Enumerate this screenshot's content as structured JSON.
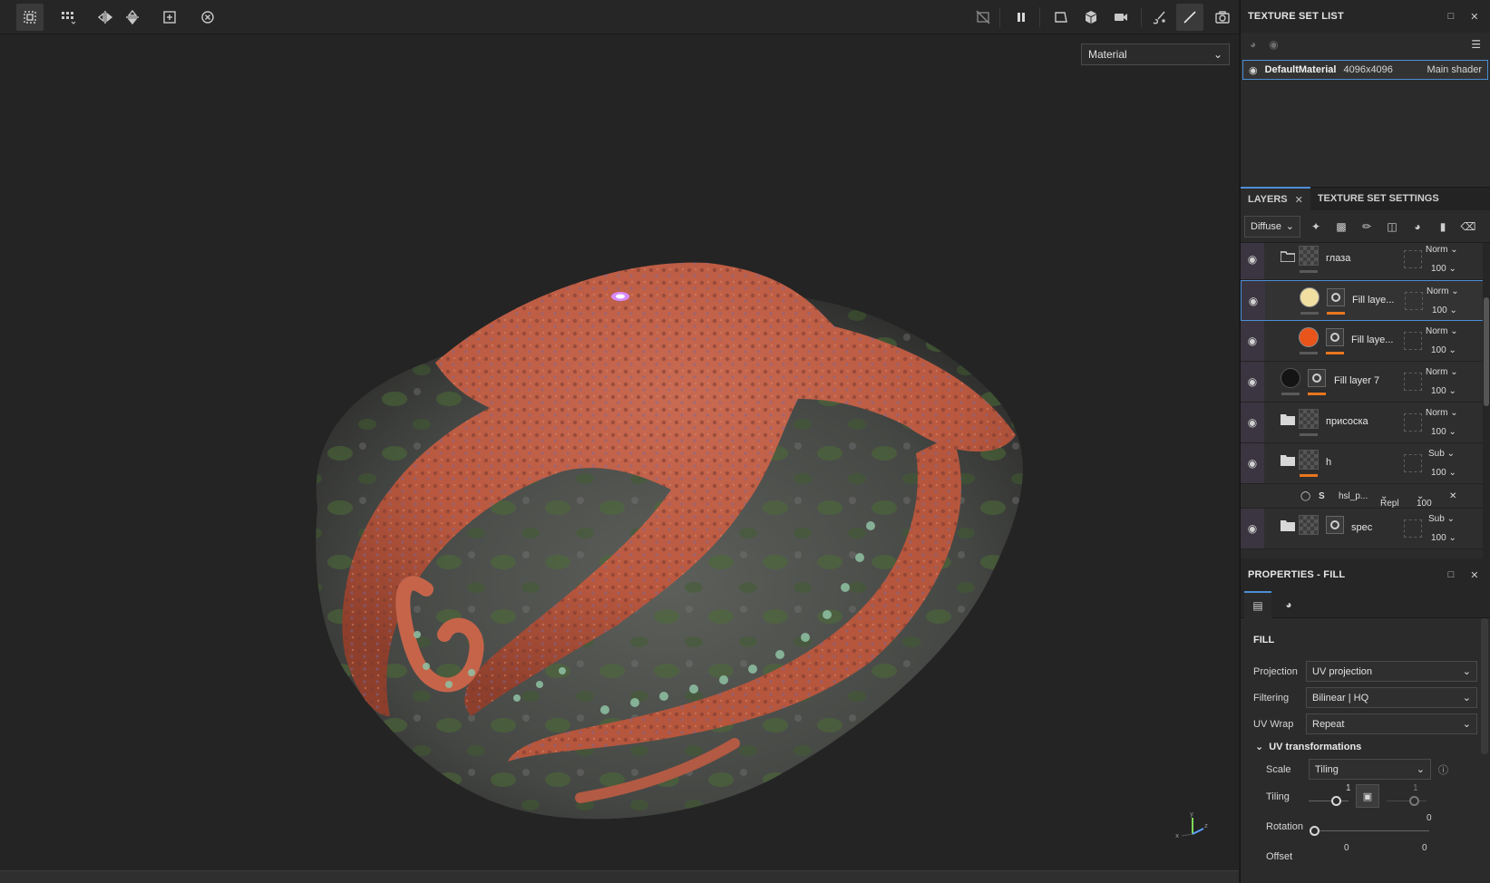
{
  "toolbar": {
    "left_icons": [
      "grid-select-icon",
      "grid-layout-icon",
      "symmetry-x-icon",
      "symmetry-y-icon",
      "add-frame-icon",
      "reset-camera-icon"
    ],
    "right_icons": [
      "hide-ui-icon",
      "pause-icon",
      "perspective-icon",
      "cube-icon",
      "camera-icon",
      "brush-settings-icon",
      "paint-brush-icon",
      "screenshot-icon"
    ]
  },
  "viewport": {
    "channel_select": "Material",
    "axis_labels": {
      "x": "x",
      "y": "y",
      "z": "z"
    }
  },
  "texture_set_list": {
    "title": "TEXTURE SET LIST",
    "item": {
      "name": "DefaultMaterial",
      "resolution": "4096x4096",
      "shader": "Main shader"
    }
  },
  "layers_panel": {
    "tabs": [
      {
        "label": "LAYERS",
        "active": true
      },
      {
        "label": "TEXTURE SET SETTINGS",
        "active": false
      }
    ],
    "channel": "Diffuse",
    "tool_icons": [
      "magic-wand-icon",
      "smart-mask-icon",
      "paint-layer-icon",
      "fill-layer-icon",
      "smart-material-icon",
      "folder-icon",
      "delete-icon"
    ],
    "layers": [
      {
        "name": "глаза",
        "kind": "folder-open",
        "blend": "Norm",
        "opacity": "100",
        "indent": 0
      },
      {
        "name": "Fill laye...",
        "kind": "fill",
        "color": "#f1dfa2",
        "blend": "Norm",
        "opacity": "100",
        "indent": 1,
        "selected": true
      },
      {
        "name": "Fill laye...",
        "kind": "fill",
        "color": "#e8541a",
        "blend": "Norm",
        "opacity": "100",
        "indent": 1
      },
      {
        "name": "Fill layer 7",
        "kind": "fill-dark",
        "color": "#141414",
        "blend": "Norm",
        "opacity": "100",
        "indent": 0
      },
      {
        "name": "присоска",
        "kind": "folder",
        "blend": "Norm",
        "opacity": "100",
        "indent": 0
      },
      {
        "name": "h",
        "kind": "folder",
        "blend": "Sub",
        "opacity": "100",
        "indent": 0
      },
      {
        "name": "spec",
        "kind": "folder",
        "blend": "Sub",
        "opacity": "100",
        "indent": 0
      }
    ],
    "filter_row": {
      "name": "hsl_p...",
      "blend": "Repl",
      "opacity": "100"
    }
  },
  "properties": {
    "title": "PROPERTIES - FILL",
    "section": "FILL",
    "projection": {
      "label": "Projection",
      "value": "UV projection"
    },
    "filtering": {
      "label": "Filtering",
      "value": "Bilinear | HQ"
    },
    "uv_wrap": {
      "label": "UV Wrap",
      "value": "Repeat"
    },
    "uv_transformations": "UV transformations",
    "scale": {
      "label": "Scale",
      "value": "Tiling"
    },
    "tiling": {
      "label": "Tiling",
      "u": "1",
      "v": "1"
    },
    "rotation": {
      "label": "Rotation",
      "value": "0"
    },
    "offset": {
      "label": "Offset",
      "u": "0",
      "v": "0"
    }
  }
}
